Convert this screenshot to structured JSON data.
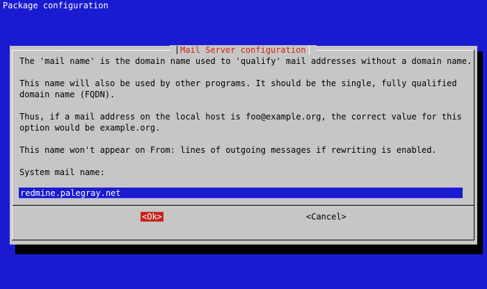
{
  "backtitle": "Package configuration",
  "dialog": {
    "title": "Mail Server configuration",
    "paragraphs": [
      "The 'mail name' is the domain name used to 'qualify' mail addresses without a domain name.",
      "This name will also be used by other programs. It should be the single, fully qualified",
      "domain name (FQDN).",
      "Thus, if a mail address on the local host is foo@example.org, the correct value for this",
      "option would be example.org.",
      "This name won't appear on From: lines of outgoing messages if rewriting is enabled.",
      "System mail name:"
    ],
    "input_value": "redmine.palegray.net",
    "ok_label": "<Ok>",
    "cancel_label": "<Cancel>"
  },
  "colors": {
    "screen_background": "#1a1bd1",
    "dialog_background": "#c6c6c6",
    "title_color": "#c8261b",
    "selected_button": "#c8261b"
  }
}
